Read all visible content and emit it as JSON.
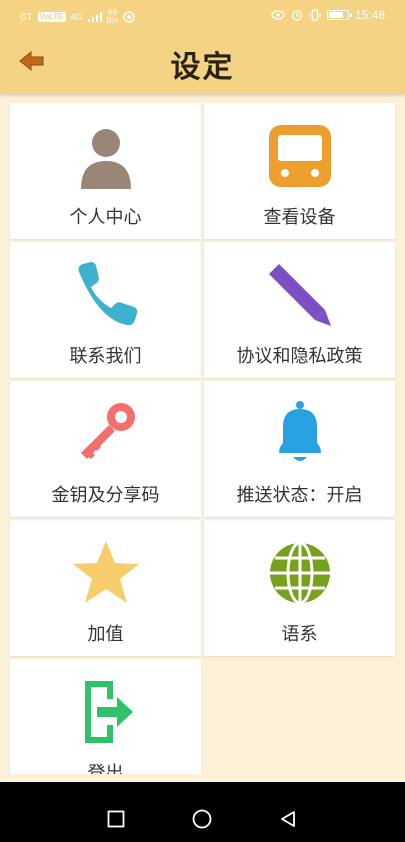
{
  "status_bar": {
    "carrier": "GT",
    "network_badge": "VoLTE",
    "signal": "4G",
    "speed_top": "69",
    "speed_bottom": "B/s",
    "time": "15:48",
    "battery_level": 0.85
  },
  "header": {
    "title": "设定",
    "back_icon": "back-arrow-icon"
  },
  "tiles": [
    {
      "label": "个人中心",
      "icon": "person-icon",
      "color": "#9a8674"
    },
    {
      "label": "查看设备",
      "icon": "device-bus-icon",
      "color": "#ec9f2c"
    },
    {
      "label": "联系我们",
      "icon": "phone-icon",
      "color": "#3fb1cf"
    },
    {
      "label": "协议和隐私政策",
      "icon": "pencil-icon",
      "color": "#7c4fc4"
    },
    {
      "label": "金钥及分享码",
      "icon": "key-icon",
      "color": "#f26f6e"
    },
    {
      "label": "推送状态：开启",
      "icon": "bell-icon",
      "color": "#29a0e1"
    },
    {
      "label": "加值",
      "icon": "star-icon",
      "color": "#f5cd6a"
    },
    {
      "label": "语系",
      "icon": "globe-icon",
      "color": "#77a11d"
    },
    {
      "label": "登出",
      "icon": "logout-icon",
      "color": "#2ec26a"
    }
  ],
  "nav_bar": {
    "recent": "recent-apps-icon",
    "home": "home-icon",
    "back": "back-icon"
  },
  "colors": {
    "header_bg": "#f4d384",
    "page_bg": "#fbf1d9",
    "tile_bg": "#ffffff"
  }
}
